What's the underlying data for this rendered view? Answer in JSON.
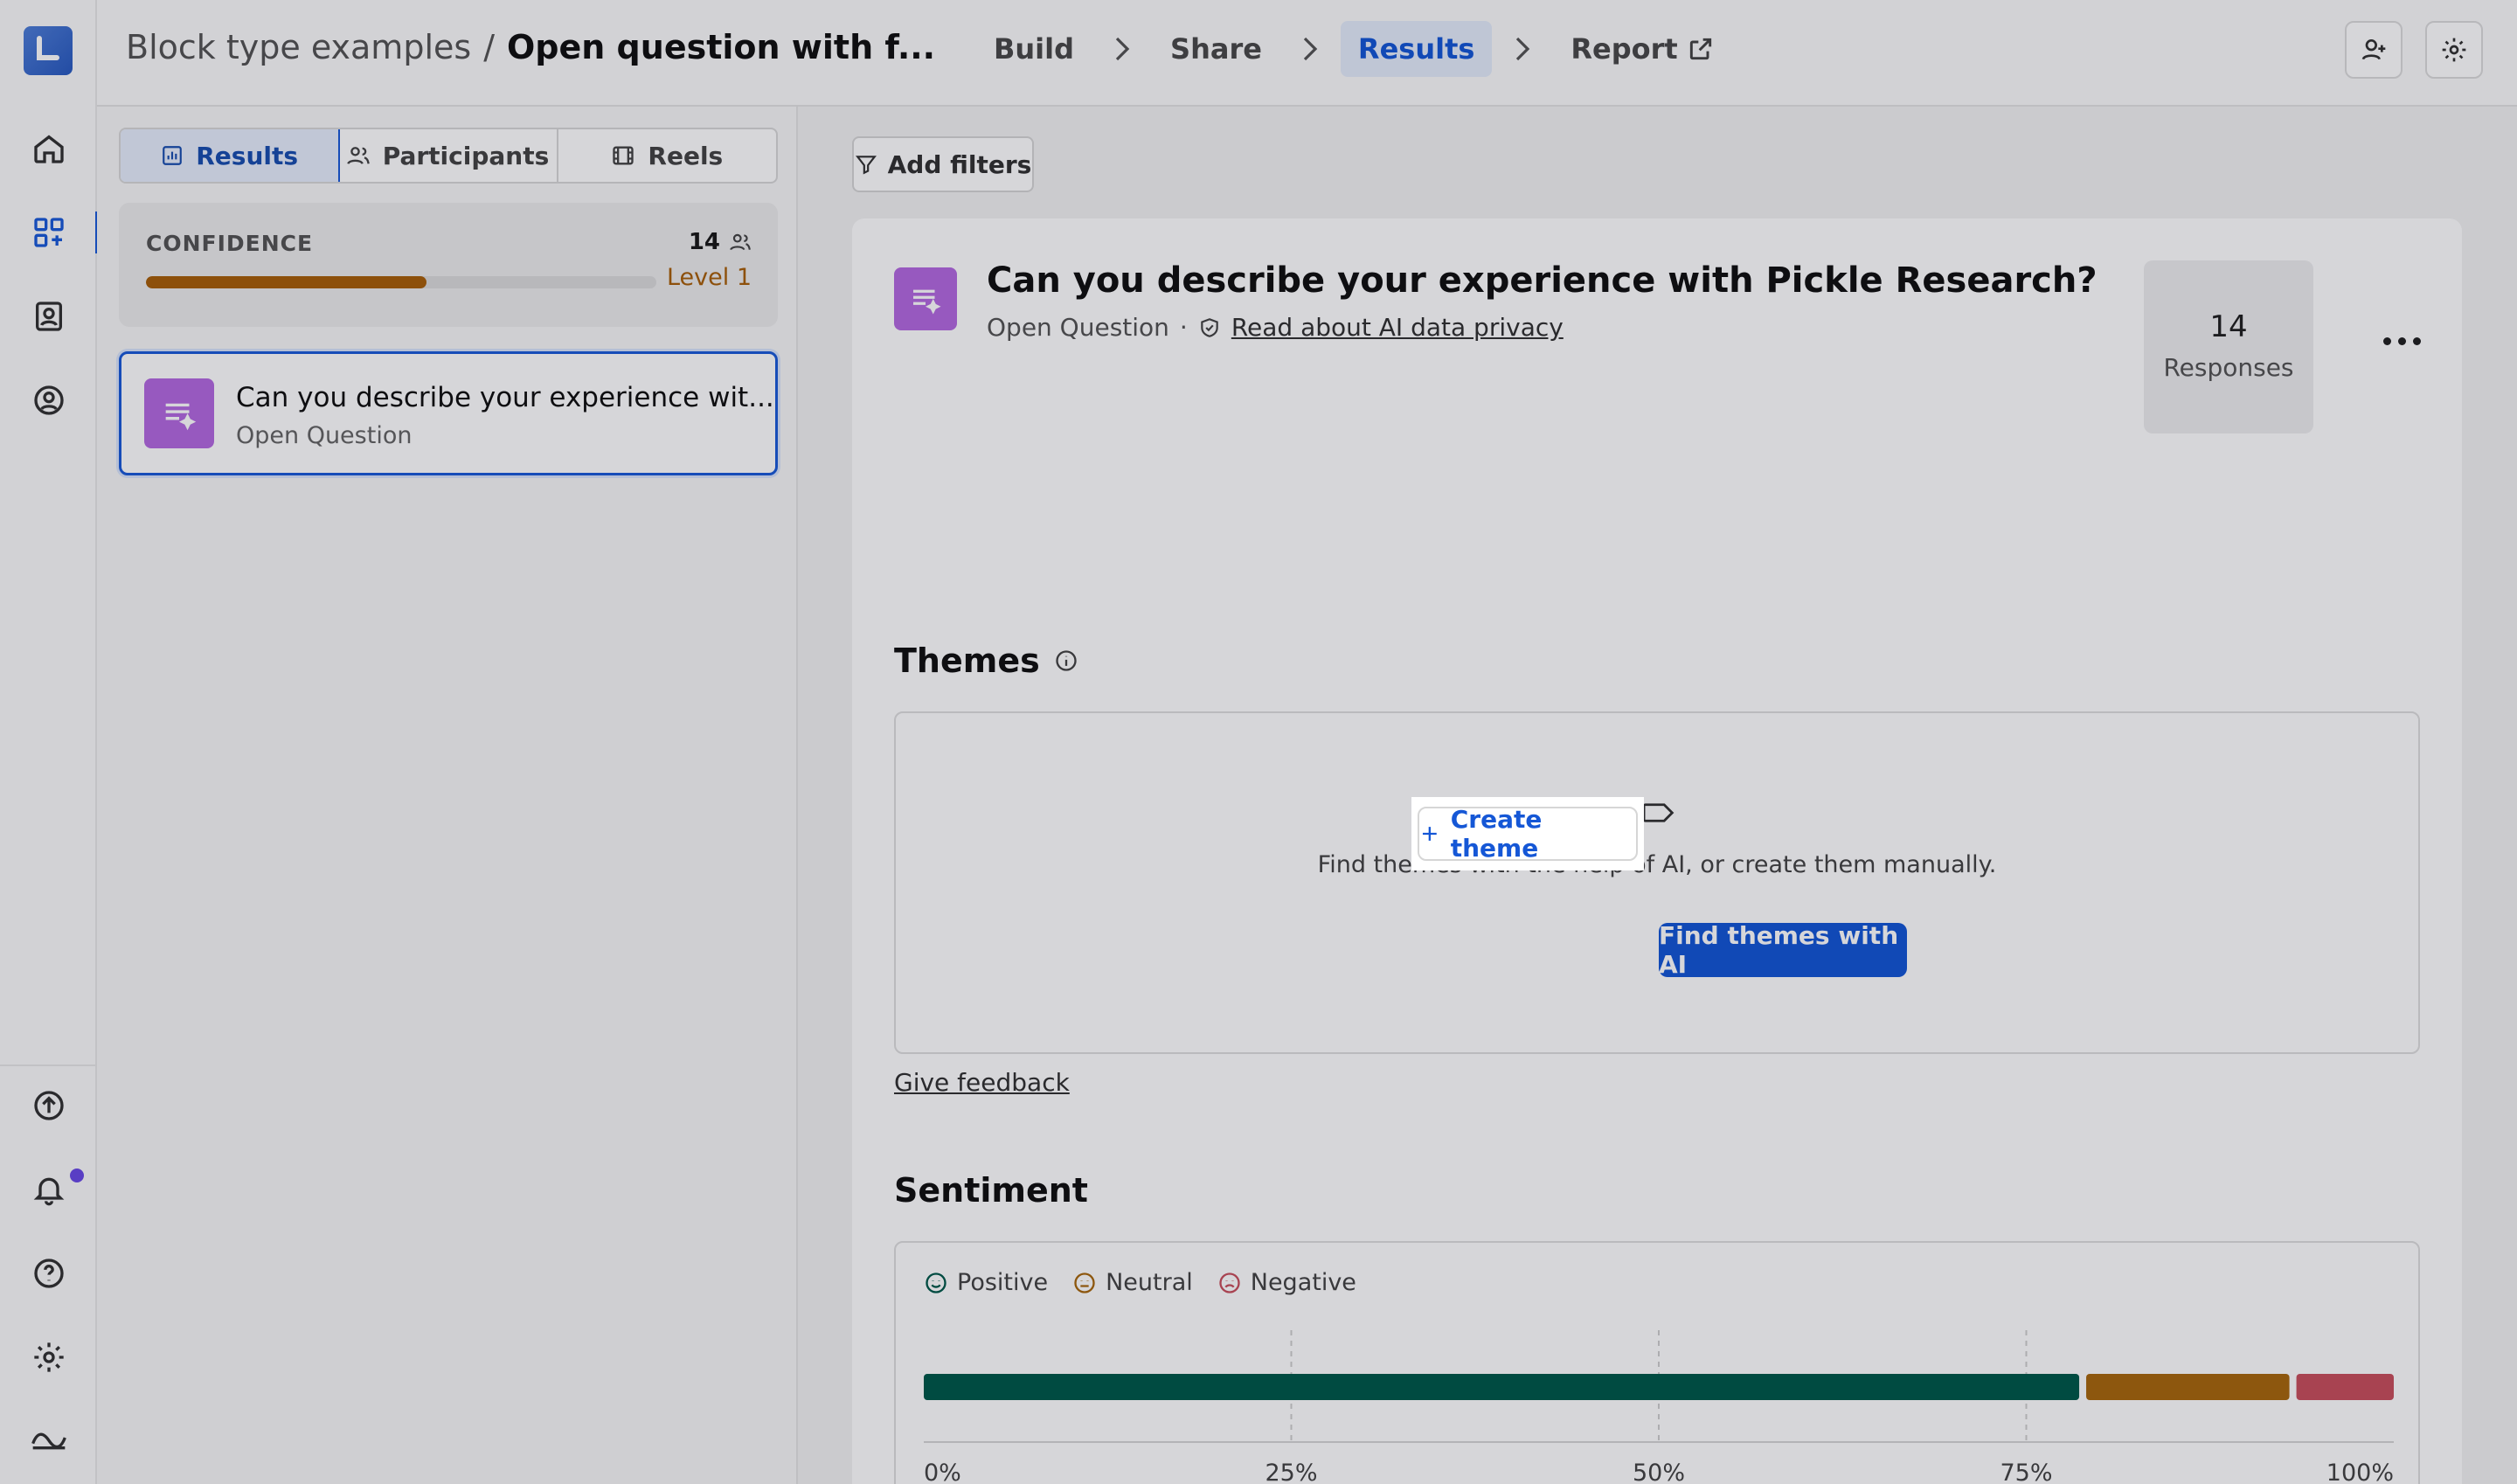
{
  "breadcrumb": {
    "project": "Block type examples",
    "separator": "/",
    "current": "Open question with f..."
  },
  "steps": [
    {
      "label": "Build"
    },
    {
      "label": "Share"
    },
    {
      "label": "Results"
    },
    {
      "label": "Report"
    }
  ],
  "tabs": [
    {
      "label": "Results"
    },
    {
      "label": "Participants"
    },
    {
      "label": "Reels"
    }
  ],
  "confidence": {
    "label": "CONFIDENCE",
    "count": "14",
    "level": "Level 1",
    "progress": 0.55
  },
  "question_card": {
    "title": "Can you describe your experience wit...",
    "type": "Open Question"
  },
  "filters": {
    "label": "Add filters"
  },
  "question": {
    "title": "Can you describe your experience with Pickle Research?",
    "type": "Open Question",
    "meta_separator": "·",
    "privacy_link": "Read about AI data privacy",
    "responses_count": "14",
    "responses_label": "Responses"
  },
  "themes": {
    "title": "Themes",
    "message": "Find themes with the help of AI, or create them manually.",
    "create_label": "Create theme",
    "ai_label": "Find themes with AI",
    "feedback_label": "Give feedback"
  },
  "sentiment": {
    "title": "Sentiment",
    "legend": [
      {
        "label": "Positive",
        "color": "#005a4a"
      },
      {
        "label": "Neutral",
        "color": "#a8680e"
      },
      {
        "label": "Negative",
        "color": "#c9505e"
      }
    ]
  },
  "chart_data": {
    "type": "bar",
    "orientation": "horizontal-stacked",
    "series": [
      {
        "name": "Positive",
        "values": [
          78.6
        ]
      },
      {
        "name": "Neutral",
        "values": [
          14.3
        ]
      },
      {
        "name": "Negative",
        "values": [
          7.1
        ]
      }
    ],
    "x_ticks": [
      "0%",
      "25%",
      "50%",
      "75%",
      "100%"
    ],
    "xlim": [
      0,
      100
    ],
    "grid": true
  }
}
